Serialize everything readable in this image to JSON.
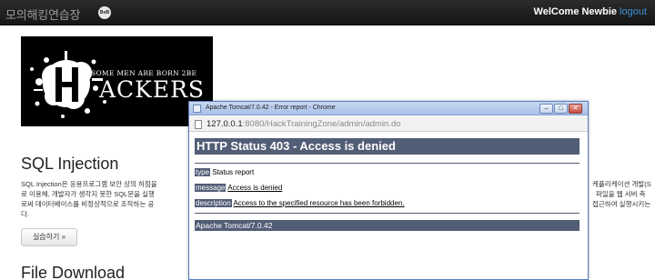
{
  "navbar": {
    "brand": "모의해킹연습장",
    "badge": "BoB",
    "welcome": "WelCome Newbie",
    "logout": "logout"
  },
  "logo": {
    "tagline": "SOME MEN ARE BORN 2BE",
    "word": "ACKERS"
  },
  "sql_section": {
    "title": "SQL Injection",
    "desc_left": [
      "SQL Injection은 응용프로그램 보안 상의 허점을",
      "로 이용해, 개발자가 생각지 못한 SQL문을 실행",
      "로써 데이터베이스를 비정상적으로 조작하는 공",
      "다."
    ],
    "desc_right": [
      "케플리케이션 개발(S",
      "파일을 웹 서버 측",
      "접근하여 실행시키는"
    ],
    "button": "실습하기 »"
  },
  "file_section": {
    "title": "File Download"
  },
  "popup": {
    "window_title": "Apache Tomcat/7.0.42 - Error report - Chrome",
    "url_host": "127.0.0.1",
    "url_rest": ":8080/HackTrainingZone/admin/admin.do",
    "heading": "HTTP Status 403 - Access is denied",
    "rows": [
      {
        "label": "type",
        "value": "Status report"
      },
      {
        "label": "message",
        "value": "Access is denied"
      },
      {
        "label": "description",
        "value": "Access to the specified resource has been forbidden."
      }
    ],
    "footer": "Apache Tomcat/7.0.42"
  }
}
